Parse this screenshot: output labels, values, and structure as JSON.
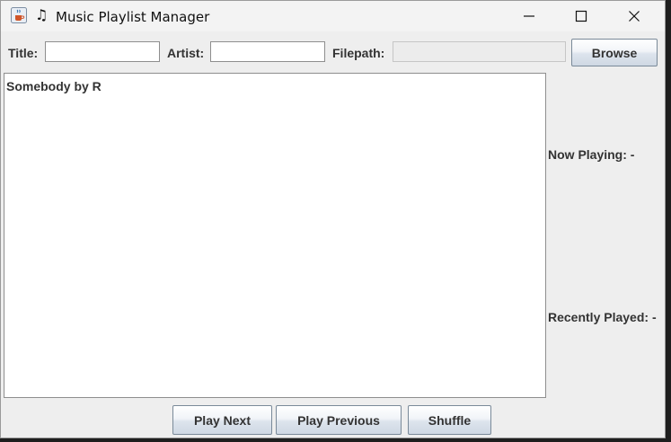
{
  "window": {
    "title": "Music Playlist Manager",
    "app_icon": "java-cup-icon",
    "title_icon": "music-note-icon",
    "note_glyph": "♫",
    "controls": {
      "minimize": "—",
      "maximize": "☐",
      "close": "✕"
    }
  },
  "form": {
    "title_label": "Title:",
    "title_value": "",
    "artist_label": "Artist:",
    "artist_value": "",
    "filepath_label": "Filepath:",
    "filepath_value": "",
    "browse_label": "Browse"
  },
  "playlist": {
    "items": [
      "Somebody by R"
    ]
  },
  "status": {
    "now_playing": "Now Playing: -",
    "recently_played": "Recently Played: -"
  },
  "controls": {
    "play_next": "Play Next",
    "play_previous": "Play Previous",
    "shuffle": "Shuffle"
  }
}
